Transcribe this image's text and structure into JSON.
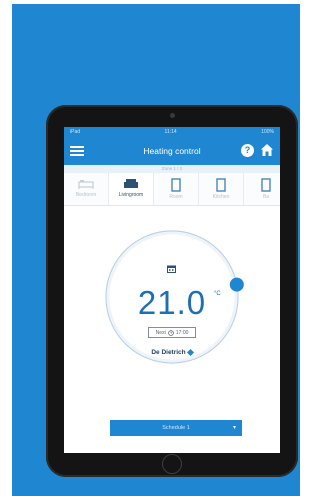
{
  "statusbar": {
    "left": "iPad",
    "center": "11:14",
    "right": "100%"
  },
  "app": {
    "title": "Heating control"
  },
  "subbar": {
    "text": "Zone 1 / 2"
  },
  "rooms": [
    {
      "label": "Bedroom",
      "icon": "bed-icon",
      "active": false
    },
    {
      "label": "Livingroom",
      "icon": "sofa-icon",
      "active": true
    },
    {
      "label": "Room",
      "icon": "door-icon",
      "active": false
    },
    {
      "label": "Kitchen",
      "icon": "door-icon",
      "active": false
    },
    {
      "label": "Ba",
      "icon": "door-icon",
      "active": false
    }
  ],
  "thermostat": {
    "temperature": "21.0",
    "unit": "°C",
    "mode_label": "Next",
    "mode_time": "17:00",
    "setpoint_fraction": 0.22
  },
  "brand": {
    "name": "De Dietrich"
  },
  "schedule": {
    "label": "Schedule 1"
  },
  "colors": {
    "accent": "#1f86d1",
    "temperature": "#1d6fb5"
  }
}
